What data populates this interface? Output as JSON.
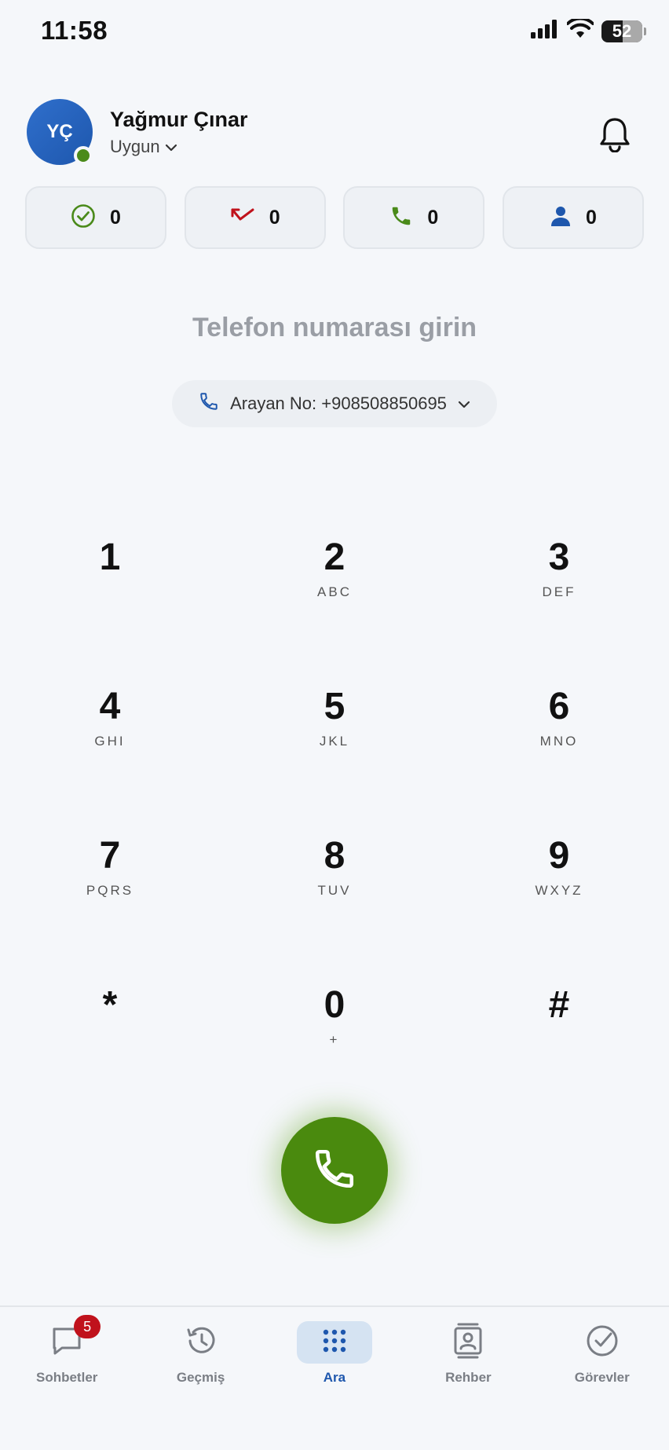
{
  "status_bar": {
    "time": "11:58",
    "battery": "52"
  },
  "profile": {
    "initials": "YÇ",
    "name": "Yağmur Çınar",
    "status": "Uygun"
  },
  "stats": [
    {
      "icon": "check-circle-icon",
      "count": "0",
      "color": "#4a8a1a"
    },
    {
      "icon": "missed-call-icon",
      "count": "0",
      "color": "#c0121c"
    },
    {
      "icon": "phone-icon",
      "count": "0",
      "color": "#4a8a1a"
    },
    {
      "icon": "person-icon",
      "count": "0",
      "color": "#1e57ad"
    }
  ],
  "dialer": {
    "placeholder": "Telefon numarası girin",
    "caller_id": "Arayan No: +908508850695"
  },
  "keypad": [
    [
      {
        "digit": "1",
        "letters": ""
      },
      {
        "digit": "2",
        "letters": "ABC"
      },
      {
        "digit": "3",
        "letters": "DEF"
      }
    ],
    [
      {
        "digit": "4",
        "letters": "GHI"
      },
      {
        "digit": "5",
        "letters": "JKL"
      },
      {
        "digit": "6",
        "letters": "MNO"
      }
    ],
    [
      {
        "digit": "7",
        "letters": "PQRS"
      },
      {
        "digit": "8",
        "letters": "TUV"
      },
      {
        "digit": "9",
        "letters": "WXYZ"
      }
    ],
    [
      {
        "digit": "*",
        "letters": ""
      },
      {
        "digit": "0",
        "letters": "+"
      },
      {
        "digit": "#",
        "letters": ""
      }
    ]
  ],
  "tabs": [
    {
      "label": "Sohbetler",
      "icon": "chat-icon",
      "badge": "5"
    },
    {
      "label": "Geçmiş",
      "icon": "history-icon"
    },
    {
      "label": "Ara",
      "icon": "dialpad-icon",
      "active": true
    },
    {
      "label": "Rehber",
      "icon": "contacts-icon"
    },
    {
      "label": "Görevler",
      "icon": "tasks-icon"
    }
  ],
  "colors": {
    "accent": "#1e57ad",
    "call_green": "#4a8a0e",
    "badge_red": "#c0121c"
  }
}
